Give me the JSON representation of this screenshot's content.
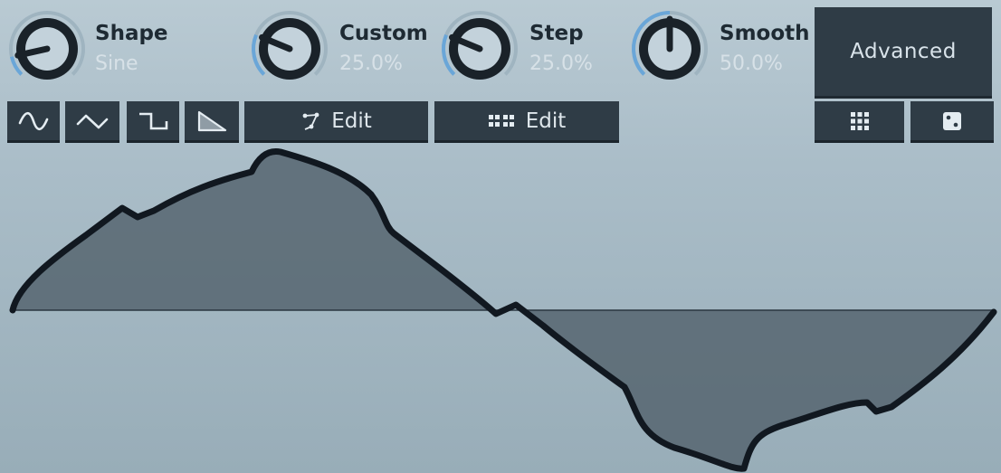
{
  "knobs": [
    {
      "id": "shape",
      "title": "Shape",
      "value": "Sine",
      "fraction": 0.12
    },
    {
      "id": "custom",
      "title": "Custom",
      "value": "25.0%",
      "fraction": 0.25
    },
    {
      "id": "step",
      "title": "Step",
      "value": "25.0%",
      "fraction": 0.25
    },
    {
      "id": "smooth",
      "title": "Smooth",
      "value": "50.0%",
      "fraction": 0.5
    }
  ],
  "advanced_label": "Advanced",
  "shape_buttons": [
    {
      "name": "sine-shape-button",
      "icon": "sine-wave-icon"
    },
    {
      "name": "triangle-shape-button",
      "icon": "triangle-wave-icon"
    },
    {
      "name": "square-shape-button",
      "icon": "square-wave-icon"
    },
    {
      "name": "saw-shape-button",
      "icon": "saw-wave-icon"
    }
  ],
  "edit_buttons": {
    "custom_label": "Edit",
    "custom_icon": "node-edit-icon",
    "step_label": "Edit",
    "step_icon": "step-edit-icon"
  },
  "tool_buttons": [
    {
      "name": "grid-button",
      "icon": "grid-icon"
    },
    {
      "name": "randomize-button",
      "icon": "dice-icon"
    }
  ],
  "colors": {
    "panel_background": "#aabdc8",
    "button_background": "#2f3c46",
    "knob_body": "#1a2229",
    "knob_arc": "#6aa6d8",
    "waveform_stroke": "#111820",
    "waveform_fill": "#566570"
  }
}
